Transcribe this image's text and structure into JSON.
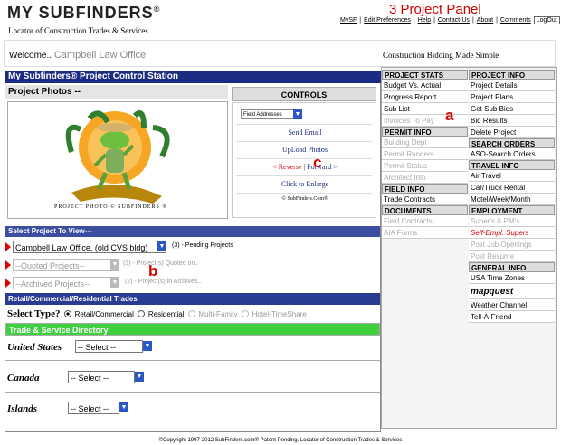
{
  "header": {
    "logo_text": "MY SUBFINDERS",
    "logo_mark": "®",
    "tagline": "Locator of Construction Trades & Services",
    "panel_title": "3 Project Panel",
    "nav": [
      "MySF",
      "Edit Preferences",
      "Help",
      "Contact-Us",
      "About",
      "Comments",
      "LogOut"
    ],
    "welcome_label": "Welcome..",
    "firm_name": "Campbell Law Office",
    "slogan": "Construction Bidding Made Simple"
  },
  "left": {
    "station_title": "My Subfinders® Project Control Station",
    "photos_title": "Project Photos --",
    "photo_caption": "PROJECT PHOTO © SUBFINDERS ®",
    "controls_title": "CONTROLS",
    "field_select": "Field Addresses",
    "send_email": "Send Email",
    "upload_photos": "UpLoad Photos",
    "reverse": "< Reverse",
    "forward": "Forward >",
    "click_enlarge": "Click to Enlarge",
    "copyright_small": "© SubFinders.Com®",
    "select_project_title": "Select Project To View---",
    "pending": {
      "value": "Campbell Law Office, (old CVS bldg)",
      "note": "(3) - Pending Projects",
      "count": "3"
    },
    "quoted": {
      "value": "--Quoted Projects--",
      "note": "(3) - Project(s) Quoted on.."
    },
    "archived": {
      "value": "--Archived Projects--",
      "note": "(2) - Project(s) in Archives.."
    },
    "trades_title": "Retail/Commercial/Residential Trades",
    "select_type_label": "Select Type?",
    "types": [
      "Retail/Commercial",
      "Residential",
      "Multi-Family",
      "Hotel-TimeShare"
    ],
    "directory_title": "Trade & Service Directory",
    "countries": [
      {
        "name": "United States",
        "value": "-- Select --"
      },
      {
        "name": "Canada",
        "value": "-- Select --"
      },
      {
        "name": "Islands",
        "value": "-- Select --"
      }
    ]
  },
  "right": {
    "project_stats": {
      "title": "PROJECT STATS",
      "items": [
        "Budget Vs. Actual",
        "Progress Report",
        "Sub List",
        "Invoices To Pay"
      ]
    },
    "permit_info": {
      "title": "PERMIT INFO",
      "items": [
        "Building Dept",
        "Permit Runners",
        "Permit Status",
        "Architect Info"
      ]
    },
    "field_info": {
      "title": "FIELD INFO",
      "items": [
        "Trade Contracts"
      ]
    },
    "documents": {
      "title": "DOCUMENTS",
      "items": [
        "Field Contracts",
        "AIA Forms"
      ]
    },
    "project_info": {
      "title": "PROJECT INFO",
      "items": [
        "Project Details",
        "Project Plans",
        "Get Sub Bids",
        "Bid Results",
        "Delete Project"
      ]
    },
    "search_orders": {
      "title": "SEARCH ORDERS",
      "items": [
        "ASO-Search Orders"
      ]
    },
    "travel_info": {
      "title": "TRAVEL INFO",
      "items": [
        "Air Travel",
        "Car/Truck Rental",
        "Motel/Week/Month"
      ]
    },
    "employment": {
      "title": "EMPLOYMENT",
      "items": [
        "Super's & PM's",
        "Self-Empl. Supers",
        "Post Job Openings",
        "Post Resume"
      ]
    },
    "general_info": {
      "title": "GENERAL INFO",
      "items": [
        "USA Time Zones",
        "mapquest",
        "Weather Channel",
        "Tell-A-Friend"
      ]
    }
  },
  "annotations": {
    "a": "a",
    "b": "b",
    "c": "c"
  },
  "footer": "©Copyright 1997-2012 SubFinders.com® Patent Pending. Locator of Construction Trades & Services"
}
